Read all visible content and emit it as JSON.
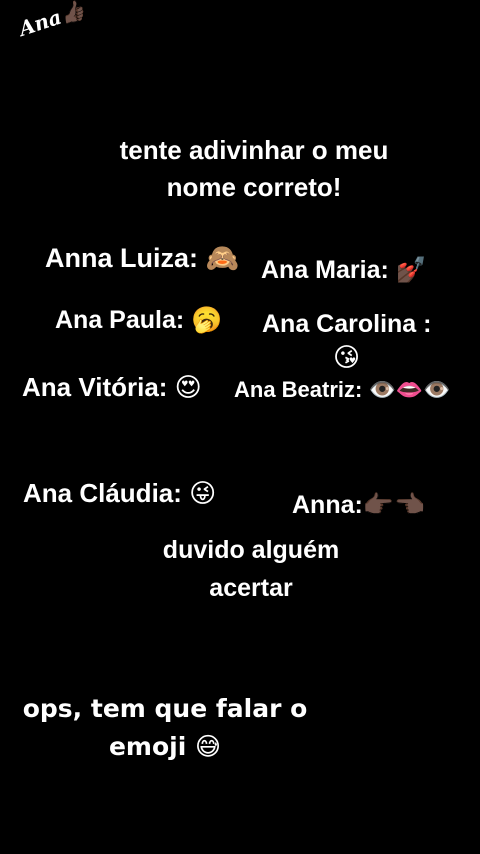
{
  "watermark": {
    "text": "Ana",
    "emoji": "👍🏿"
  },
  "title": {
    "line1": "tente adivinhar o meu",
    "line2": "nome correto!"
  },
  "options": {
    "anna_luiza": {
      "label": "Anna Luiza:",
      "emoji": "🙈"
    },
    "ana_maria": {
      "label": "Ana Maria:",
      "emoji": "💅🏿"
    },
    "ana_paula": {
      "label": "Ana Paula:",
      "emoji": "🥱"
    },
    "ana_carolina": {
      "label": "Ana Carolina :",
      "emoji": "😘"
    },
    "ana_vitoria": {
      "label": "Ana Vitória:",
      "emoji": "😍"
    },
    "ana_beatriz": {
      "label": "Ana Beatriz:",
      "emoji": "👁️👄👁️"
    },
    "ana_claudia": {
      "label": "Ana Cláudia:",
      "emoji": "😜"
    },
    "anna": {
      "label": "Anna:",
      "emoji": "👉🏿👈🏿"
    }
  },
  "challenge": {
    "line1": "duvido alguém",
    "line2": "acertar"
  },
  "footer": {
    "line1": "ops, tem que falar o",
    "line2": "emoji",
    "emoji": "😅"
  }
}
